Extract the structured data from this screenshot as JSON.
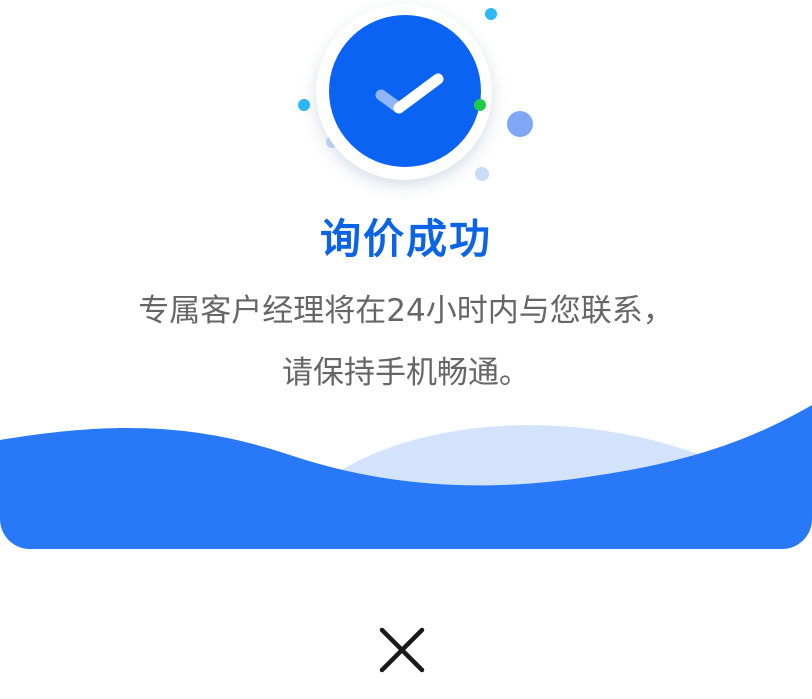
{
  "dialog": {
    "title": "询价成功",
    "message_line1": "专属客户经理将在24小时内与您联系，",
    "message_line2": "请保持手机畅通。",
    "success_icon": "check-icon",
    "close_icon": "close-icon"
  },
  "colors": {
    "primary": "#0a63f3",
    "title": "#0b63e6",
    "wave": "#2878f7",
    "wave_light": "#d3e3fb",
    "text": "#666666"
  }
}
